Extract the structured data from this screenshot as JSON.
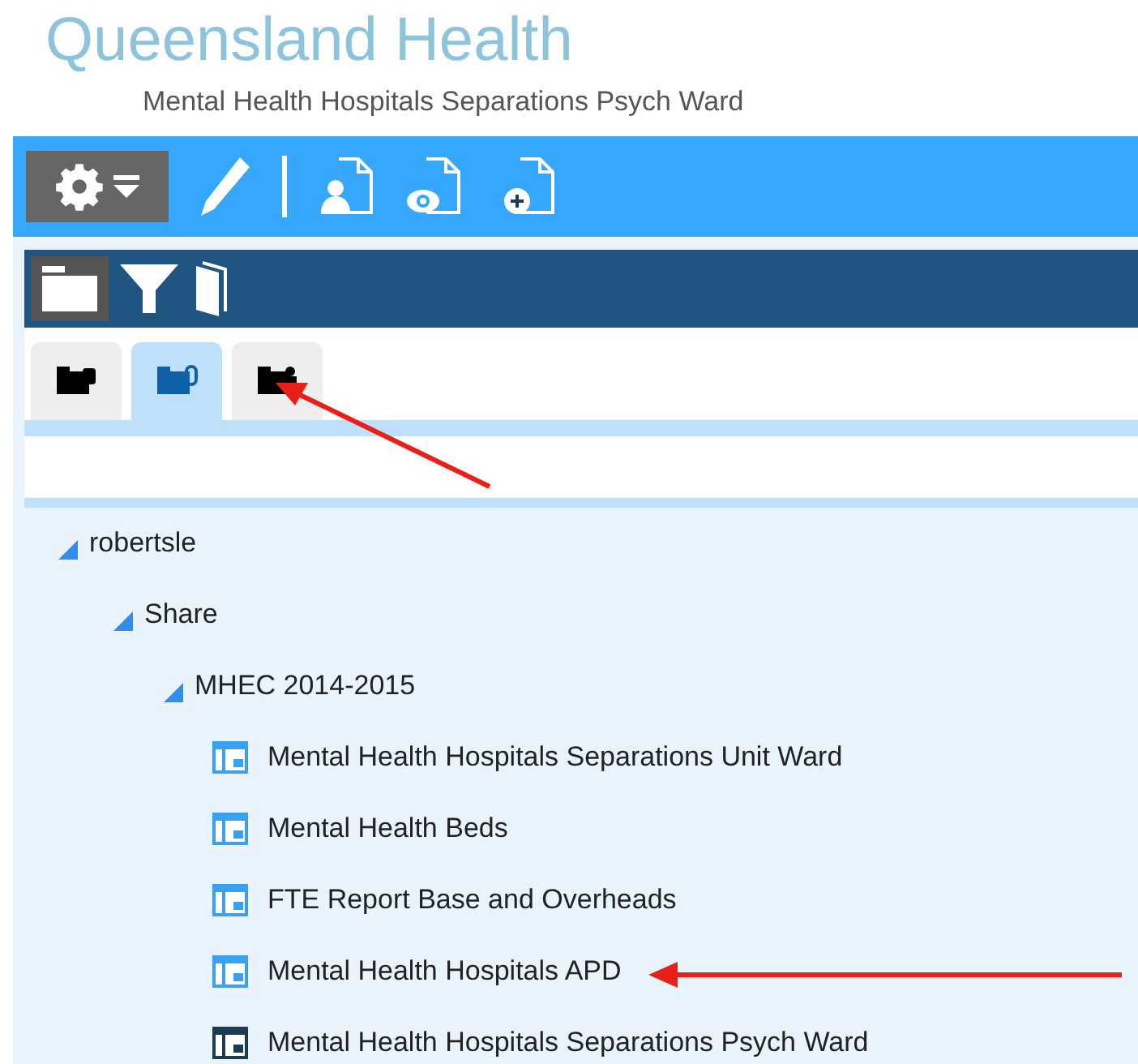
{
  "header": {
    "title": "Queensland Health",
    "subtitle": "Mental Health Hospitals Separations Psych Ward"
  },
  "folder_tabs": [
    {
      "selected": false
    },
    {
      "selected": true
    },
    {
      "selected": false
    }
  ],
  "tree": [
    {
      "label": "robertsle",
      "expanded": true,
      "children": [
        {
          "label": "Share",
          "expanded": true,
          "children": [
            {
              "label": "MHEC 2014-2015",
              "expanded": true,
              "children": [
                {
                  "label": "Mental Health Hospitals Separations Unit Ward",
                  "kind": "report",
                  "selected": false
                },
                {
                  "label": "Mental Health Beds",
                  "kind": "report",
                  "selected": false
                },
                {
                  "label": "FTE Report Base and Overheads",
                  "kind": "report",
                  "selected": false
                },
                {
                  "label": "Mental Health Hospitals APD",
                  "kind": "report",
                  "selected": false
                },
                {
                  "label": "Mental Health Hospitals Separations Psych Ward",
                  "kind": "report",
                  "selected": true
                }
              ]
            }
          ]
        }
      ]
    }
  ]
}
